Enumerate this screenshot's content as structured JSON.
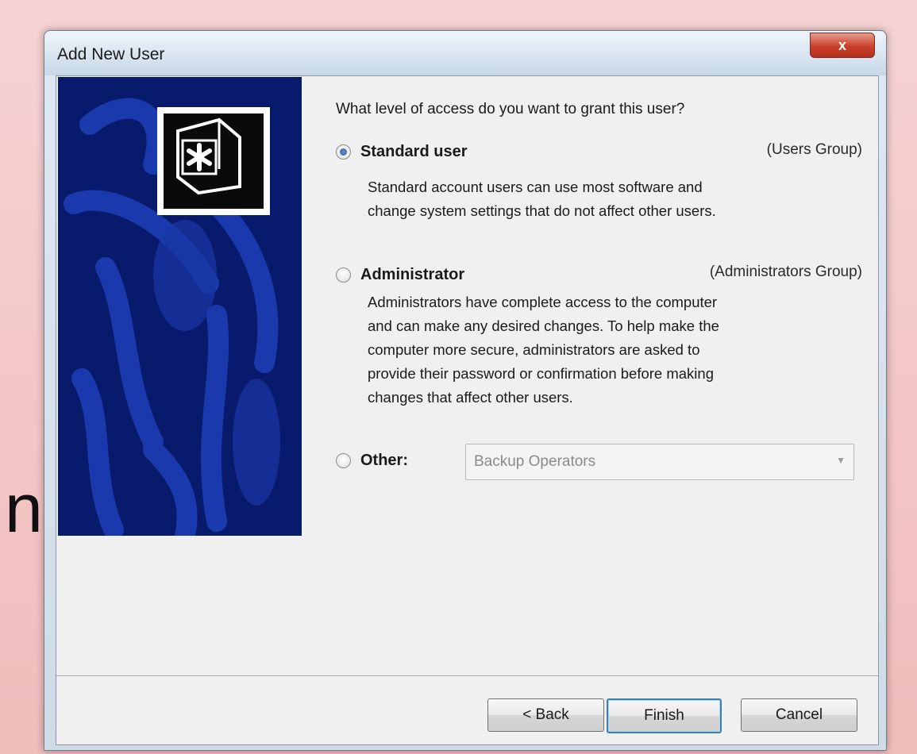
{
  "window": {
    "title": "Add New User",
    "close_glyph": "x"
  },
  "background": {
    "partial_letter": "n"
  },
  "question": "What level of access do you want to grant this user?",
  "options": [
    {
      "label": "Standard user",
      "group": "(Users Group)",
      "checked": true,
      "description": [
        "Standard account users can use most software and",
        "change system settings that do not affect other users."
      ]
    },
    {
      "label": "Administrator",
      "group": "(Administrators Group)",
      "checked": false,
      "description": [
        "Administrators have complete access to the computer",
        "and can make any desired changes. To help make the",
        "computer more secure, administrators are asked to",
        "provide their password or confirmation before making",
        "changes that affect other users."
      ]
    },
    {
      "label": "Other:",
      "checked": false,
      "select_value": "Backup Operators"
    }
  ],
  "buttons": {
    "back": "< Back",
    "finish": "Finish",
    "cancel": "Cancel"
  },
  "colors": {
    "side_panel": "#081a6b",
    "accent": "#3c7fb1",
    "close_button": "#c7412c"
  },
  "icons": {
    "wizard_logo": "key-asterisk-icon",
    "dropdown": "chevron-down-icon"
  }
}
